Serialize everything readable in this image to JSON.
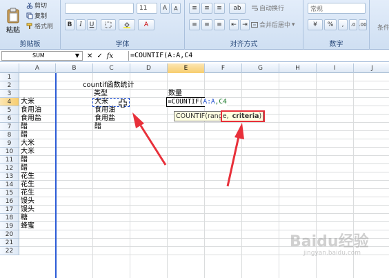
{
  "ribbon": {
    "clipboard": {
      "paste": "粘贴",
      "cut": "剪切",
      "copy": "复制",
      "format_painter": "格式刷",
      "group": "剪贴板"
    },
    "font": {
      "size": "11",
      "group": "字体"
    },
    "alignment": {
      "wrap": "自动换行",
      "merge": "合并后居中",
      "group": "对齐方式"
    },
    "number": {
      "format": "常规",
      "group": "数字",
      "percent": "%"
    },
    "styles": {
      "partial": "条件"
    }
  },
  "formula_bar": {
    "name_box": "SUM",
    "fx": "fx",
    "cancel": "✕",
    "enter": "✓",
    "formula": "=COUNTIF(A:A,C4"
  },
  "columns": [
    "A",
    "B",
    "C",
    "D",
    "E",
    "F",
    "G",
    "H",
    "I",
    "J"
  ],
  "rows": [
    "1",
    "2",
    "3",
    "4",
    "5",
    "6",
    "7",
    "8",
    "9",
    "10",
    "11",
    "12",
    "13",
    "14",
    "15",
    "16",
    "17",
    "18",
    "19",
    "20",
    "21",
    "22"
  ],
  "cells": {
    "A4": "大米",
    "A5": "食用油",
    "A6": "食用盐",
    "A7": "醋",
    "A8": "醋",
    "A9": "大米",
    "A10": "大米",
    "A11": "醋",
    "A12": "醋",
    "A13": "花生",
    "A14": "花生",
    "A15": "花生",
    "A16": "馒头",
    "A17": "馒头",
    "A18": "糖",
    "A19": "蜂蜜",
    "C2": "countif函数统计",
    "C3": "类型",
    "C4": "大米",
    "C5": "食用油",
    "C6": "食用盐",
    "C7": "醋",
    "E3": "数量",
    "E4_a": "=COUNTIF(",
    "E4_b": "A:A",
    "E4_c": ",C4"
  },
  "tooltip": {
    "fn": "COUNTIF(",
    "range": "range,",
    "criteria": "criteria",
    "close": ")"
  },
  "watermark": "Baidu经验",
  "watermark_url": "jingyan.baidu.com",
  "colors": {
    "annotation": "#e8303a",
    "ref_blue": "#1f4ecf"
  }
}
